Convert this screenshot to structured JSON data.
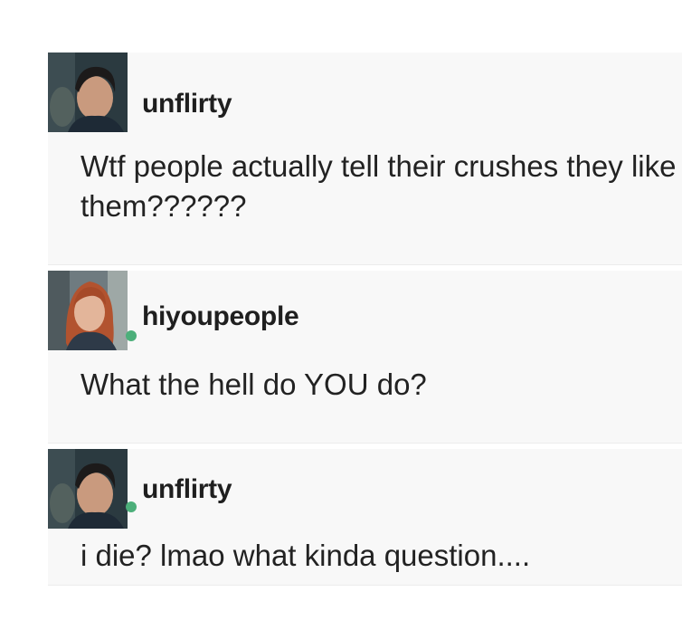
{
  "posts": [
    {
      "avatar": "boy-avatar",
      "username": "unflirty",
      "text": "Wtf people actually tell their crushes they like them??????"
    },
    {
      "avatar": "girl-avatar",
      "username": "hiyoupeople",
      "text": "What the hell do YOU do?"
    },
    {
      "avatar": "boy-avatar",
      "username": "unflirty",
      "text": "i die? lmao what kinda question...."
    }
  ],
  "colors": {
    "post_background": "#f8f8f8",
    "text": "#222222",
    "online_dot": "#4caf7a"
  }
}
